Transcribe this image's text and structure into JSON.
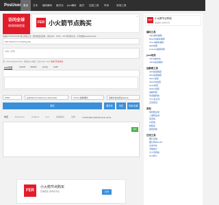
{
  "nav": {
    "brand": "PosUson",
    "items": [
      "首页",
      "文本",
      "编码解码",
      "格式化",
      "json解析",
      "格式",
      "加密工具",
      "时间",
      "其他工具"
    ]
  },
  "ad_left": {
    "line1": "访问全球",
    "line2": "跨境网络提速"
  },
  "ad_banner": {
    "logo": "FER",
    "title": "小火箭节点购买",
    "close": "x"
  },
  "description": "在线HTTP/POST/GET接口测试工具，服务端发送请求，支持GET、POST、PUT等请求方法，可带参数/Header/Cookie",
  "url_input": {
    "value": "http://www.xxx.com/ping.php"
  },
  "params": {
    "placeholder": "请输入参数"
  },
  "hint": {
    "text": "例：user=abc&pwd=123，参数为json格式，如{\"name\":\"aa\"}",
    "red": "请求字符串提交"
  },
  "body_tabs": [
    "post参数",
    "cookie",
    "header",
    "proxy",
    "code"
  ],
  "selects": {
    "method": "POST",
    "content_type": "application/x-www-form-urlencoded",
    "charset": "UTF-8 (请求编码)",
    "extra": "请求方式(支持get/post)"
  },
  "buttons": {
    "submit": "提交",
    "format": "格式化",
    "clear": "清空",
    "save": "保存/加载"
  },
  "response_tabs": [
    "响应",
    "Response",
    "Headers",
    "Curl",
    "请求信息",
    "请求"
  ],
  "timestamp": "1747673604 2025-05-20 01:33:24",
  "copy_label": "复制",
  "sidebar": {
    "ad": {
      "logo": "FER",
      "title": "小火箭节点购买",
      "subtitle": "高速稳定 支持全平台"
    },
    "sections": [
      {
        "title": "编码工具",
        "links": [
          "URL编码/解码",
          "Base64编码/解码",
          "UTF-8编码/解码",
          "MD5加密",
          "Unicode编码转换"
        ]
      },
      {
        "title": "json相关",
        "links": [
          "JSON格式化",
          "JSON在线解析"
        ]
      },
      {
        "title": "加解密工具",
        "links": [
          "AES加密解密",
          "RSA加密解密",
          "SHA1加密",
          "SHA256加密",
          "Hash加密",
          "HMAC加密",
          "进制转换",
          "时间戳转换",
          "Cron表达式",
          "正则测试"
        ]
      },
      {
        "title": "其他",
        "links": [
          "随机数生成",
          "二维码生成",
          "条形码",
          "IP查询",
          "短链接",
          "颜色转换"
        ]
      },
      {
        "title": "在线工具",
        "links": [
          "图片压缩",
          "图片转Base64",
          "文本对比",
          "字数统计",
          "大小写转换",
          "Html转义"
        ]
      }
    ]
  },
  "bottom_ad": {
    "logo": "FER",
    "title": "小火箭节点购买",
    "subtitle": "高速稳定 支持全平台",
    "button": "打开"
  }
}
